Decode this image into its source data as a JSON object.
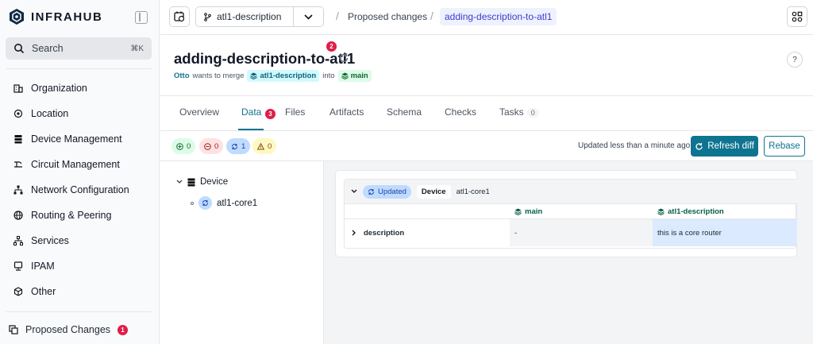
{
  "app": {
    "logo": "INFRAHUB"
  },
  "sidebar": {
    "search": {
      "label": "Search",
      "shortcut": "⌘K"
    },
    "items": [
      {
        "label": "Organization",
        "icon": "building-icon"
      },
      {
        "label": "Location",
        "icon": "location-pin-icon"
      },
      {
        "label": "Device Management",
        "icon": "server-icon"
      },
      {
        "label": "Circuit Management",
        "icon": "circuit-icon"
      },
      {
        "label": "Network Configuration",
        "icon": "network-icon"
      },
      {
        "label": "Routing & Peering",
        "icon": "globe-icon"
      },
      {
        "label": "Services",
        "icon": "hierarchy-icon"
      },
      {
        "label": "IPAM",
        "icon": "ip-icon"
      },
      {
        "label": "Other",
        "icon": "cube-icon"
      }
    ],
    "proposed_changes": {
      "label": "Proposed Changes",
      "badge": "1"
    }
  },
  "topbar": {
    "branch": "atl1-description",
    "breadcrumb": {
      "sep1": "/",
      "item1": "Proposed changes",
      "sep2": "/",
      "item2": "adding-description-to-atl1"
    }
  },
  "header": {
    "title": "adding-description-to-atl1",
    "badge": "2",
    "author": "Otto",
    "wants_to_merge": "wants to merge",
    "source_branch": "atl1-description",
    "into": "into",
    "target_branch": "main",
    "help": "?"
  },
  "tabs": [
    {
      "label": "Overview"
    },
    {
      "label": "Data",
      "badge": "3"
    },
    {
      "label": "Files"
    },
    {
      "label": "Artifacts"
    },
    {
      "label": "Schema"
    },
    {
      "label": "Checks"
    },
    {
      "label": "Tasks",
      "count": "0"
    }
  ],
  "toolbar": {
    "stats": {
      "added": "0",
      "removed": "0",
      "updated": "1",
      "conflicts": "0"
    },
    "updated_text": "Updated less than a minute ago",
    "refresh_label": "Refresh diff",
    "rebase_label": "Rebase"
  },
  "tree": {
    "group": "Device",
    "node": "atl1-core1"
  },
  "diff": {
    "status": "Updated",
    "kind": "Device",
    "name": "atl1-core1",
    "col_main": "main",
    "col_branch": "atl1-description",
    "rows": [
      {
        "attribute": "description",
        "main": "-",
        "branch": "this is a core router"
      }
    ]
  },
  "colors": {
    "accent": "#0e7490",
    "badge_red": "#e11d48",
    "updated_blue": "#bfdbfe"
  }
}
